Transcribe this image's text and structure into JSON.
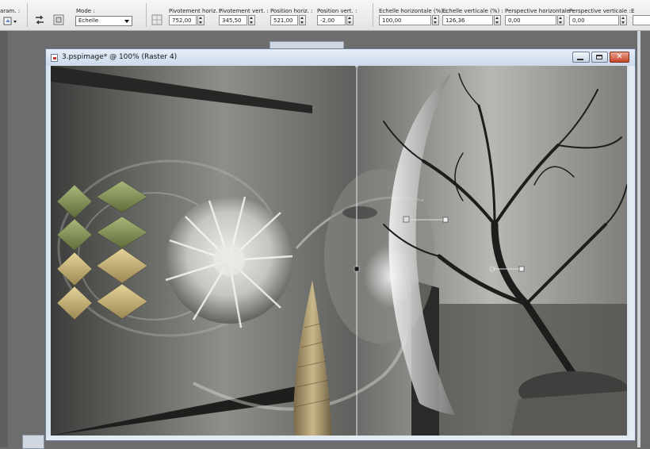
{
  "toolbar": {
    "params_label": "aram. :",
    "mode_label": "Mode :",
    "mode_value": "Echelle",
    "fields": [
      {
        "label": "Pivotement horiz. :",
        "value": "752,00"
      },
      {
        "label": "Pivotement vert. :",
        "value": "345,50"
      },
      {
        "label": "Position horiz. :",
        "value": "521,00"
      },
      {
        "label": "Position vert. :",
        "value": "-2,00"
      },
      {
        "label": "Echelle horizontale (%) :",
        "value": "100,00"
      },
      {
        "label": "Echelle verticale (%) :",
        "value": "126,36"
      },
      {
        "label": "Perspective horizontale :",
        "value": "0,00"
      },
      {
        "label": "Perspective verticale :",
        "value": "0,00"
      }
    ],
    "truncated_label": "E"
  },
  "document": {
    "title": "3.pspimage* @ 100% (Raster 4)"
  },
  "colors": {
    "toolbar_bg": "#ececec",
    "workspace_bg": "#6d6d6d",
    "window_frame": "#d9e4f1",
    "close_button": "#c5442a"
  }
}
